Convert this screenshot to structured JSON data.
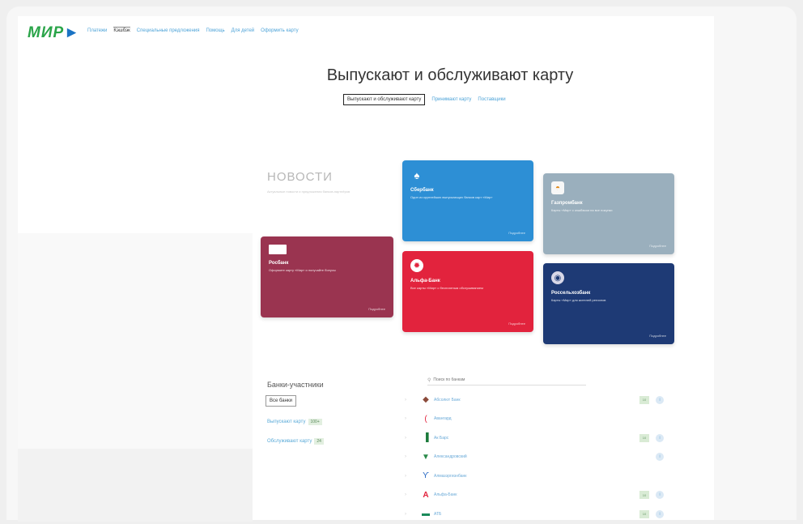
{
  "header": {
    "logo": "МИР",
    "nav": [
      {
        "label": "Платежи",
        "active": false
      },
      {
        "label": "Кэшбэк",
        "active": true
      },
      {
        "label": "Специальные предложения",
        "active": false
      },
      {
        "label": "Помощь",
        "active": false
      },
      {
        "label": "Для детей",
        "active": false
      },
      {
        "label": "Оформить карту",
        "active": false
      }
    ]
  },
  "page": {
    "title": "Выпускают и обслуживают карту",
    "subnav": {
      "active": "Выпускают и обслуживают карту",
      "links": [
        "Принимают карту",
        "Поставщики"
      ]
    }
  },
  "news": {
    "title": "НОВОСТИ",
    "text": "Актуальные новости и предложения банков-партнёров"
  },
  "cards": {
    "sber": {
      "name": "Сбербанк",
      "desc": "Один из крупнейших выпускающих банков карт «Мир»",
      "more": "Подробнее",
      "color": "#2d8fd5",
      "icon": "leaf-icon"
    },
    "gaz": {
      "name": "Газпромбанк",
      "desc": "Карты «Мир» с кэшбэком на все покупки",
      "more": "Подробнее",
      "color": "#9aafbd",
      "icon": "fan-icon"
    },
    "ros": {
      "name": "Росбанк",
      "desc": "Оформите карту «Мир» и получайте бонусы",
      "more": "Подробнее",
      "color": "#9a3450",
      "icon": "flag-icon"
    },
    "alfa": {
      "name": "Альфа-Банк",
      "desc": "Все карты «Мир» с бесплатным обслуживанием",
      "more": "Подробнее",
      "color": "#e2233d",
      "icon": "gear-icon"
    },
    "rshb": {
      "name": "Россельхозбанк",
      "desc": "Карты «Мир» для жителей регионов",
      "more": "Подробнее",
      "color": "#1e3a75",
      "icon": "globe-icon"
    }
  },
  "banks": {
    "title": "Банки-участники",
    "all_button": "Все банки",
    "link1": "Выпускают карту",
    "link1_tag": "100+",
    "link2": "Обслуживают карту",
    "link2_tag": "24"
  },
  "search": {
    "placeholder": "Поиск по банкам"
  },
  "bank_list": [
    {
      "name": "Абсолют Банк",
      "icon": "bank-icon",
      "badge": "10",
      "info": "i"
    },
    {
      "name": "Авангард",
      "icon": "bank-icon",
      "badge": "",
      "info": ""
    },
    {
      "name": "Ак Барс",
      "icon": "bank-icon",
      "badge": "10",
      "info": "i"
    },
    {
      "name": "Александровский",
      "icon": "bank-icon",
      "badge": "",
      "info": "i"
    },
    {
      "name": "Алмазэргиэнбанк",
      "icon": "bank-icon",
      "badge": "",
      "info": ""
    },
    {
      "name": "Альфа-Банк",
      "icon": "bank-icon",
      "badge": "10",
      "info": "i"
    },
    {
      "name": "АТБ",
      "icon": "bank-icon",
      "badge": "10",
      "info": "i"
    }
  ]
}
